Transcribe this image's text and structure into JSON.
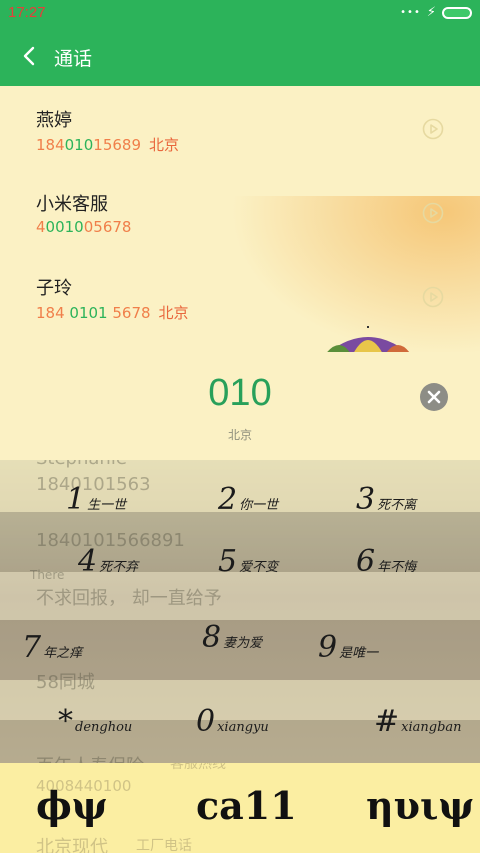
{
  "status_bar": {
    "time": "17:27",
    "signal_icon": "signal-dots-icon",
    "charging_icon": "bolt-icon",
    "battery_icon": "battery-icon"
  },
  "app_bar": {
    "title": "通话",
    "back_icon": "chevron-left-icon"
  },
  "contacts": [
    {
      "name": "燕婷",
      "num_pre": "184",
      "num_match": "010",
      "num_post": "15689",
      "location": "北京"
    },
    {
      "name": "小米客服",
      "num_pre": "4",
      "num_match": "0010",
      "num_post": "05678",
      "location": ""
    },
    {
      "name": "子玲",
      "num_pre": "184 ",
      "num_match": "0101",
      "num_post": " 5678",
      "location": "北京"
    }
  ],
  "dialer": {
    "input": "010",
    "location": "北京",
    "clear_icon": "clear-x-icon"
  },
  "keys": [
    {
      "digit": "1",
      "caption": "生一世"
    },
    {
      "digit": "2",
      "caption": "你一世"
    },
    {
      "digit": "3",
      "caption": "死不离"
    },
    {
      "digit": "4",
      "caption": "死不弃"
    },
    {
      "digit": "5",
      "caption": "爱不变"
    },
    {
      "digit": "6",
      "caption": "年不悔"
    },
    {
      "digit": "7",
      "caption": "年之痒"
    },
    {
      "digit": "8",
      "caption": "妻为爱"
    },
    {
      "digit": "9",
      "caption": "是唯一"
    },
    {
      "digit": "*",
      "caption": "denghou"
    },
    {
      "digit": "0",
      "caption": "xiangyu"
    },
    {
      "digit": "#",
      "caption": "xiangban"
    }
  ],
  "background_text": {
    "g1": "Stephanie",
    "g2": "1840101563",
    "g3": "1840101566891",
    "g4": "There",
    "g5": "不求回报， 却一直给予",
    "g6": "58同城",
    "g7": "百年人寿保险",
    "g8": "客服热线",
    "g9": "4008440100",
    "g10": "北京现代",
    "g11": "工厂电话"
  },
  "bottom_bar": {
    "left": "ϕψ",
    "center": "ca11",
    "right": "ηυιψ"
  },
  "colors": {
    "brand_green": "#2cb35a",
    "number_orange": "#f07f4a",
    "status_time_red": "#e5403a"
  }
}
